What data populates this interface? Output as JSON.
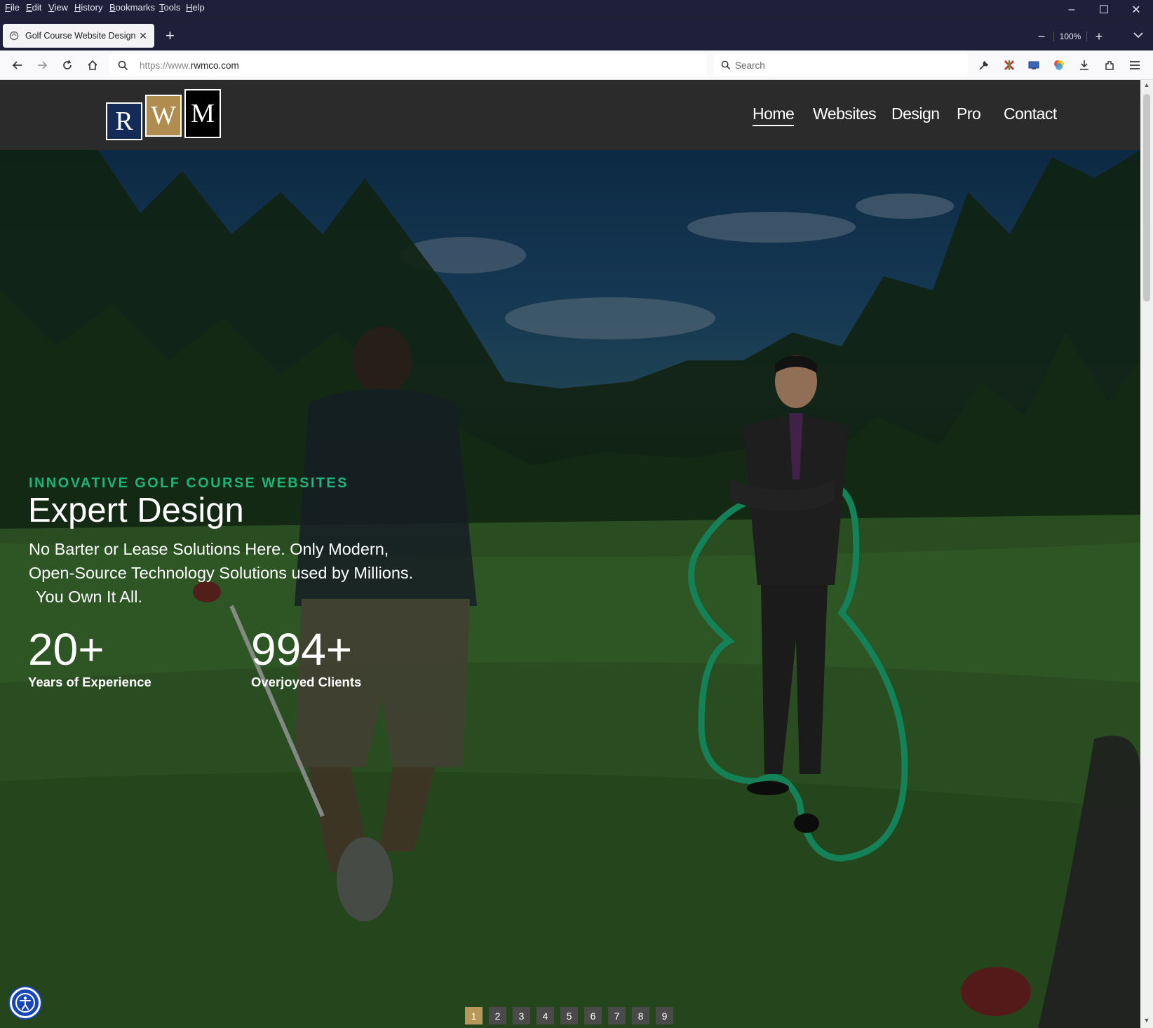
{
  "browser": {
    "menu": [
      "File",
      "Edit",
      "View",
      "History",
      "Bookmarks",
      "Tools",
      "Help"
    ],
    "tab_title": "Golf Course Website Design by",
    "url_prefix": "https://www.",
    "url_host": "rwmco.com",
    "search_placeholder": "Search",
    "zoom": "100%",
    "zoom_minus": "−",
    "zoom_plus": "+",
    "new_tab": "+"
  },
  "site": {
    "logo_letters": [
      "R",
      "W",
      "M"
    ],
    "logo_colors": {
      "r": "#152b57",
      "w": "#b08d4e",
      "m": "#000000"
    },
    "nav": [
      {
        "label": "Home",
        "active": true
      },
      {
        "label": "Websites",
        "active": false
      },
      {
        "label": "Design",
        "active": false
      },
      {
        "label": "Pro",
        "active": false
      },
      {
        "label": "Contact",
        "active": false
      }
    ]
  },
  "hero": {
    "eyebrow": "INNOVATIVE GOLF COURSE WEBSITES",
    "headline": "Expert Design",
    "subtext_line1": "No Barter or Lease Solutions Here. Only Modern,",
    "subtext_line2": "Open-Source Technology Solutions used by Millions.",
    "subtext_line3": "You Own It All.",
    "stats": [
      {
        "number": "20+",
        "label": "Years of Experience"
      },
      {
        "number": "994+",
        "label": "Overjoyed Clients"
      }
    ],
    "accent_color": "#1db37a"
  },
  "pager": {
    "pages": [
      "1",
      "2",
      "3",
      "4",
      "5",
      "6",
      "7",
      "8",
      "9"
    ],
    "active_page": "1",
    "active_color": "#b8975a"
  }
}
